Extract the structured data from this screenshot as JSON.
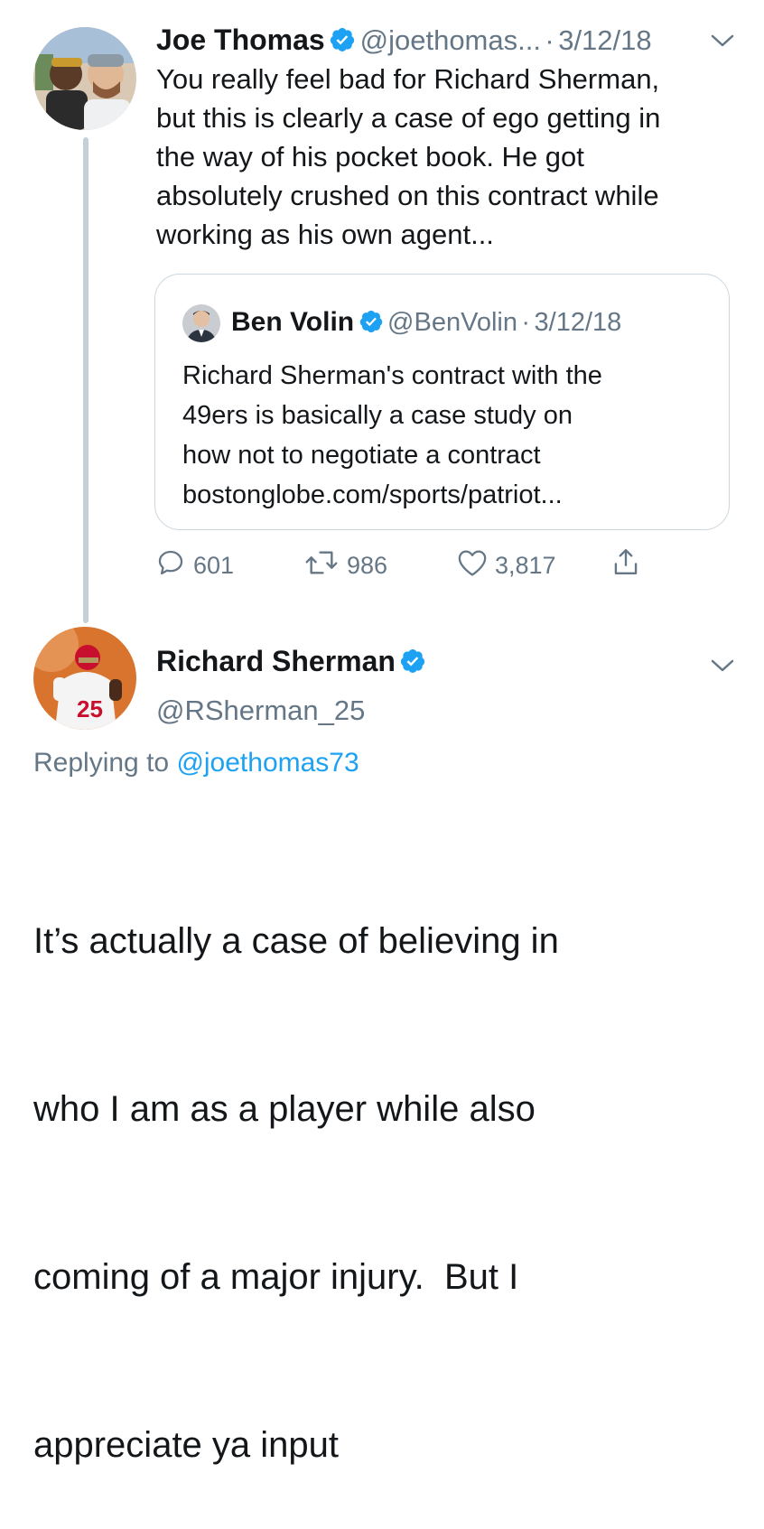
{
  "tweet": {
    "author_name": "Joe Thomas",
    "author_handle": "@joethomas...",
    "separator": "·",
    "date": "3/12/18",
    "text_lines": [
      "You really feel bad for Richard Sherman,",
      "but this is clearly a case of ego getting in",
      "the way of his pocket book. He got",
      "absolutely crushed on this contract while",
      "working as his own agent..."
    ],
    "quote": {
      "author_name": "Ben Volin",
      "author_handle": "@BenVolin",
      "separator": "·",
      "date": "3/12/18",
      "text_lines": [
        "Richard Sherman's contract with the",
        "49ers is basically a case study on",
        "how not to negotiate a contract",
        "bostonglobe.com/sports/patriot..."
      ]
    },
    "actions": {
      "replies": "601",
      "retweets": "986",
      "likes": "3,817"
    }
  },
  "reply": {
    "author_name": "Richard Sherman",
    "author_handle": "@RSherman_25",
    "replying_label": "Replying to",
    "replying_handle": "@joethomas73",
    "text_lines": [
      "It’s actually a case of believing in",
      "who I am as a player while also",
      "coming of a major injury.  But I",
      "appreciate ya input"
    ]
  },
  "colors": {
    "verified_blue": "#1da1f2",
    "secondary_text": "#657786",
    "link_blue": "#1da1f2",
    "border": "#ccd6dd"
  },
  "icons": [
    "verified-badge-icon",
    "chevron-down-icon",
    "reply-icon",
    "retweet-icon",
    "like-icon",
    "share-icon"
  ]
}
